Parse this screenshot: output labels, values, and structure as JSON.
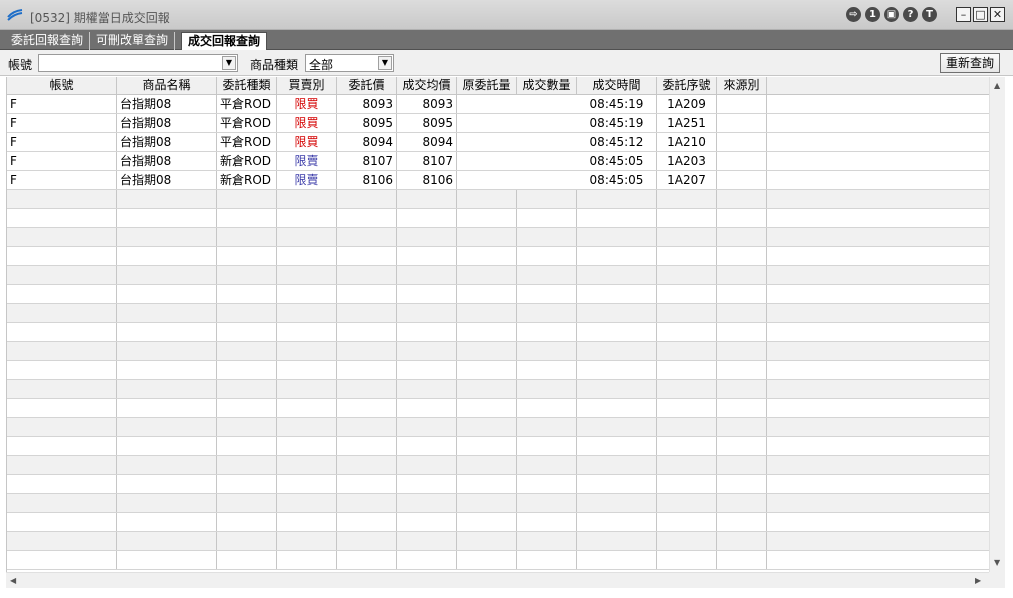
{
  "window": {
    "title": "[0532] 期權當日成交回報",
    "toolbar_icons": [
      {
        "name": "exit-icon",
        "glyph": "⇨"
      },
      {
        "name": "info-icon",
        "glyph": "1"
      },
      {
        "name": "window-icon",
        "glyph": "▣"
      },
      {
        "name": "help-icon",
        "glyph": "?"
      },
      {
        "name": "t-icon",
        "glyph": "T"
      }
    ],
    "window_buttons": {
      "minimize": "–",
      "maximize": "□",
      "close": "✕"
    }
  },
  "tabs": [
    {
      "label": "委託回報查詢",
      "active": false
    },
    {
      "label": "可刪改單查詢",
      "active": false
    },
    {
      "label": "成交回報查詢",
      "active": true
    }
  ],
  "filter": {
    "account_label": "帳號",
    "account_value": "",
    "product_type_label": "商品種類",
    "product_type_value": "全部",
    "requery_button": "重新查詢"
  },
  "table": {
    "columns": [
      "帳號",
      "商品名稱",
      "委託種類",
      "買賣別",
      "委託價",
      "成交均價",
      "原委託量",
      "成交數量",
      "成交時間",
      "委託序號",
      "來源別"
    ],
    "rows": [
      {
        "account": "F",
        "product": "台指期08",
        "order_type": "平倉ROD",
        "side": "限買",
        "order_price": "8093",
        "avg_price": "8093",
        "orig_qty": "",
        "fill_qty": "",
        "time": "08:45:19",
        "seq": "1A209",
        "source": ""
      },
      {
        "account": "F",
        "product": "台指期08",
        "order_type": "平倉ROD",
        "side": "限買",
        "order_price": "8095",
        "avg_price": "8095",
        "orig_qty": "",
        "fill_qty": "",
        "time": "08:45:19",
        "seq": "1A251",
        "source": ""
      },
      {
        "account": "F",
        "product": "台指期08",
        "order_type": "平倉ROD",
        "side": "限買",
        "order_price": "8094",
        "avg_price": "8094",
        "orig_qty": "",
        "fill_qty": "",
        "time": "08:45:12",
        "seq": "1A210",
        "source": ""
      },
      {
        "account": "F",
        "product": "台指期08",
        "order_type": "新倉ROD",
        "side": "限賣",
        "order_price": "8107",
        "avg_price": "8107",
        "orig_qty": "",
        "fill_qty": "",
        "time": "08:45:05",
        "seq": "1A203",
        "source": ""
      },
      {
        "account": "F",
        "product": "台指期08",
        "order_type": "新倉ROD",
        "side": "限賣",
        "order_price": "8106",
        "avg_price": "8106",
        "orig_qty": "",
        "fill_qty": "",
        "time": "08:45:05",
        "seq": "1A207",
        "source": ""
      }
    ]
  },
  "colors": {
    "buy": "#d40000",
    "sell": "#3a3aa8",
    "tab_strip": "#707070"
  }
}
